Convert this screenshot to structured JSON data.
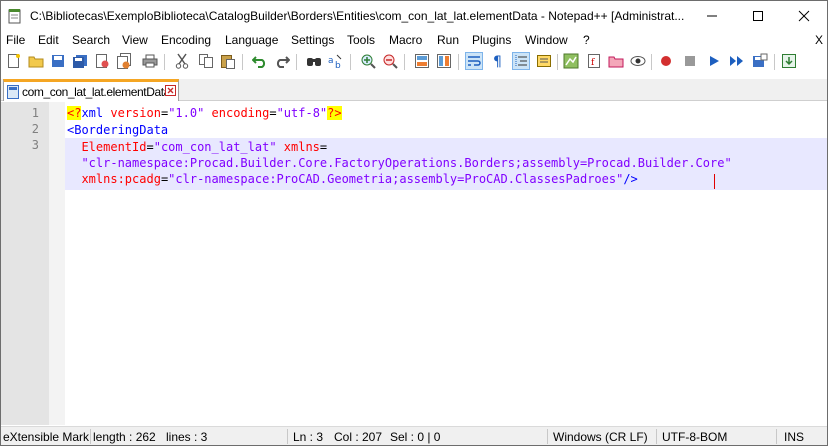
{
  "window": {
    "title": "C:\\Bibliotecas\\ExemploBiblioteca\\CatalogBuilder\\Borders\\Entities\\com_con_lat_lat.elementData - Notepad++ [Administrat..."
  },
  "menu": {
    "items": [
      "File",
      "Edit",
      "Search",
      "View",
      "Encoding",
      "Language",
      "Settings",
      "Tools",
      "Macro",
      "Run",
      "Plugins",
      "Window",
      "?"
    ],
    "close_doc": "X"
  },
  "toolbar": {
    "icons": [
      "new-file-icon",
      "open-file-icon",
      "save-icon",
      "save-all-icon",
      "close-icon",
      "close-all-icon",
      "print-icon",
      "cut-icon",
      "copy-icon",
      "paste-icon",
      "undo-icon",
      "redo-icon",
      "find-icon",
      "replace-icon",
      "zoom-in-icon",
      "zoom-out-icon",
      "sync-vertical-icon",
      "sync-horizontal-icon",
      "word-wrap-icon",
      "show-all-characters-icon",
      "indent-guide-icon",
      "user-defined-language-icon",
      "document-map-icon",
      "function-list-icon",
      "folder-as-workspace-icon",
      "monitoring-icon",
      "record-macro-icon",
      "stop-recording-icon",
      "playback-macro-icon",
      "run-macro-multiple-icon",
      "save-macro-icon",
      "user-icon"
    ]
  },
  "tabs": [
    {
      "label": "com_con_lat_lat.elementData",
      "active": true
    }
  ],
  "editor": {
    "line_numbers": [
      "1",
      "2",
      "3"
    ],
    "line1": {
      "pi_open": "<?",
      "pi_name": "xml",
      "attr1": "version",
      "eq1": "=",
      "val1": "\"1.0\"",
      "attr2": "encoding",
      "eq2": "=",
      "val2": "\"utf-8\"",
      "pi_close": "?>"
    },
    "line2": {
      "tag": "<BorderingData"
    },
    "line3a": {
      "attr1": "ElementId",
      "eq1": "=",
      "val1": "\"com_con_lat_lat\"",
      "attr2": "xmlns",
      "eq2": "="
    },
    "line3b": {
      "val": "\"clr-namespace:Procad.Builder.Core.FactoryOperations.Borders;assembly=Procad.Builder.Core\""
    },
    "line3c": {
      "attr": "xmlns:pcadg",
      "eq": "=",
      "val": "\"clr-namespace:ProCAD.Geometria;assembly=ProCAD.ClassesPadroes\"",
      "close": "/>"
    }
  },
  "status": {
    "language": "eXtensible Markup Language file",
    "length": "length : 262",
    "lines": "lines : 3",
    "ln": "Ln : 3",
    "col": "Col : 207",
    "sel": "Sel : 0 | 0",
    "eol": "Windows (CR LF)",
    "encoding": "UTF-8-BOM",
    "mode": "INS"
  },
  "colors": {
    "gutter": "#e4e4e4",
    "current_line": "#e8e8ff",
    "tag": "#0000ff",
    "attribute": "#ff0000",
    "value": "#8000ff",
    "tab_accent": "#f5a623"
  }
}
